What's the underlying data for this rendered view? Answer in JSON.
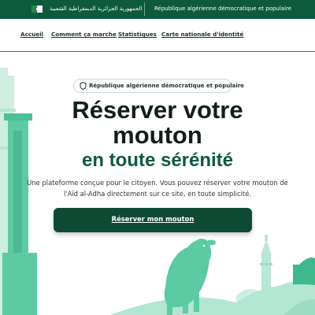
{
  "topbar": {
    "ar_label": "الجمهورية الجزائرية الديمقراطية الشعبية",
    "fr_label": "République algérienne démocratique et populaire"
  },
  "nav": {
    "items": [
      {
        "label": "Accueil"
      },
      {
        "label": "Comment ça marche"
      },
      {
        "label": "Statistiques"
      },
      {
        "label": "Carte nationale d'identité"
      }
    ]
  },
  "hero": {
    "badge": "République algérienne démocratique et populaire",
    "title_line1": "Réserver votre",
    "title_line2": "mouton",
    "title_line3": "en toute sérénité",
    "desc_line1": "Une plateforme conçue pour le citoyen. Vous pouvez réserver votre mouton de",
    "desc_line2": "l'Aïd al-Adha directement sur ce site, en toute simplicité.",
    "cta_label": "Réserver mon mouton"
  },
  "icons": {
    "flag": "algeria-flag-icon",
    "badge": "shield-icon"
  },
  "colors": {
    "primary_green": "#0e5a3d",
    "cta_green": "#0f4a34",
    "illustration_mint": "#5ccaa3",
    "nav_divider": "#cf3a3a"
  }
}
